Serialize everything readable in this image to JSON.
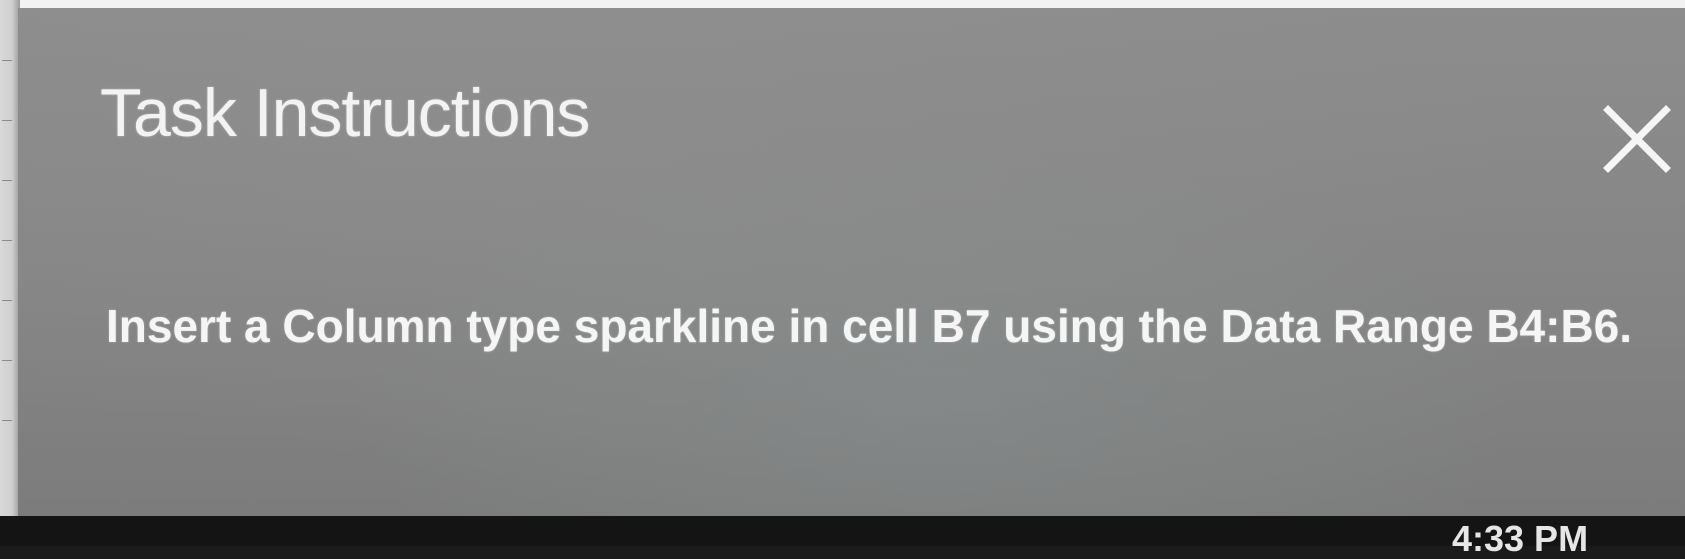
{
  "dialog": {
    "title": "Task Instructions",
    "instruction": "Insert a Column type sparkline in cell B7 using the Data Range B4:B6.",
    "close_icon": "close-icon"
  },
  "taskbar": {
    "clock": "4:33 PM"
  },
  "colors": {
    "panel_background": "#858585",
    "text": "#f3f3f3",
    "taskbar": "#141414"
  }
}
